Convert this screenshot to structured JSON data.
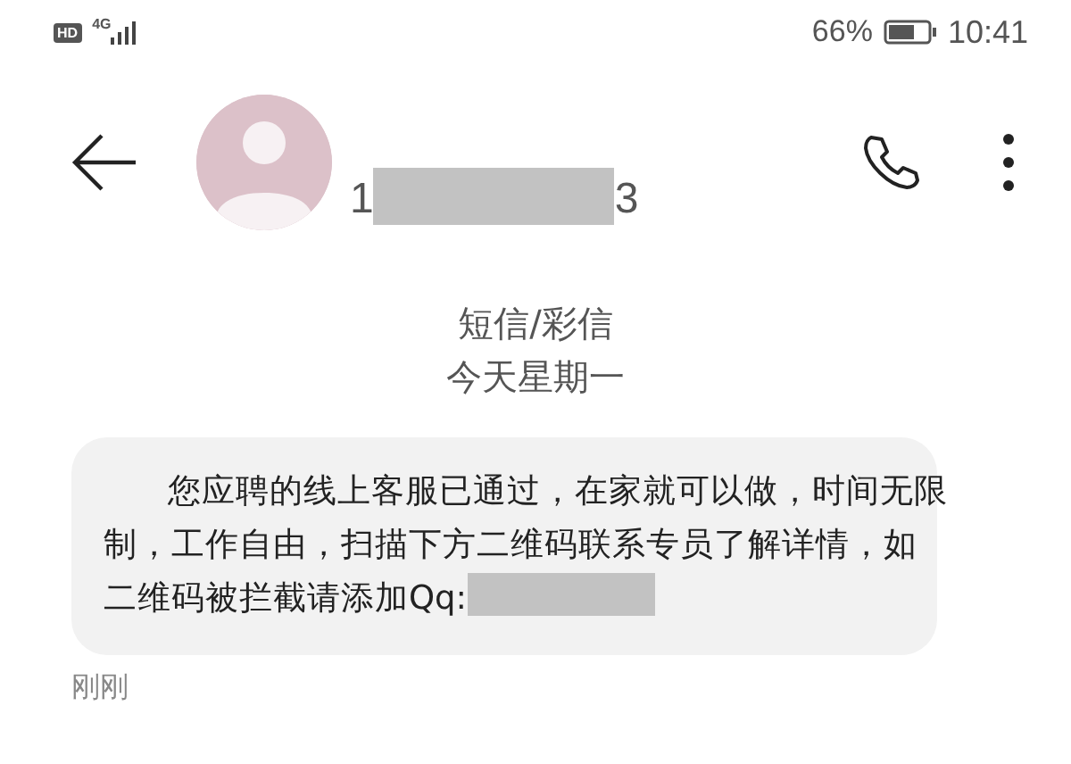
{
  "status_bar": {
    "hd": "HD",
    "network": "4G",
    "battery_percent": "66%",
    "time": "10:41"
  },
  "header": {
    "number_start": "1",
    "number_end": "3"
  },
  "conversation": {
    "channel": "短信/彩信",
    "day": "今天星期一"
  },
  "messages": [
    {
      "lines": [
        "您应聘的线上客服已通过，在家就可以做，时间无限",
        "制，工作自由，扫描下方二维码联系专员了解详情，如",
        "二维码被拦截请添加Qq:"
      ],
      "redacted_tail": true,
      "time": "刚刚"
    }
  ]
}
